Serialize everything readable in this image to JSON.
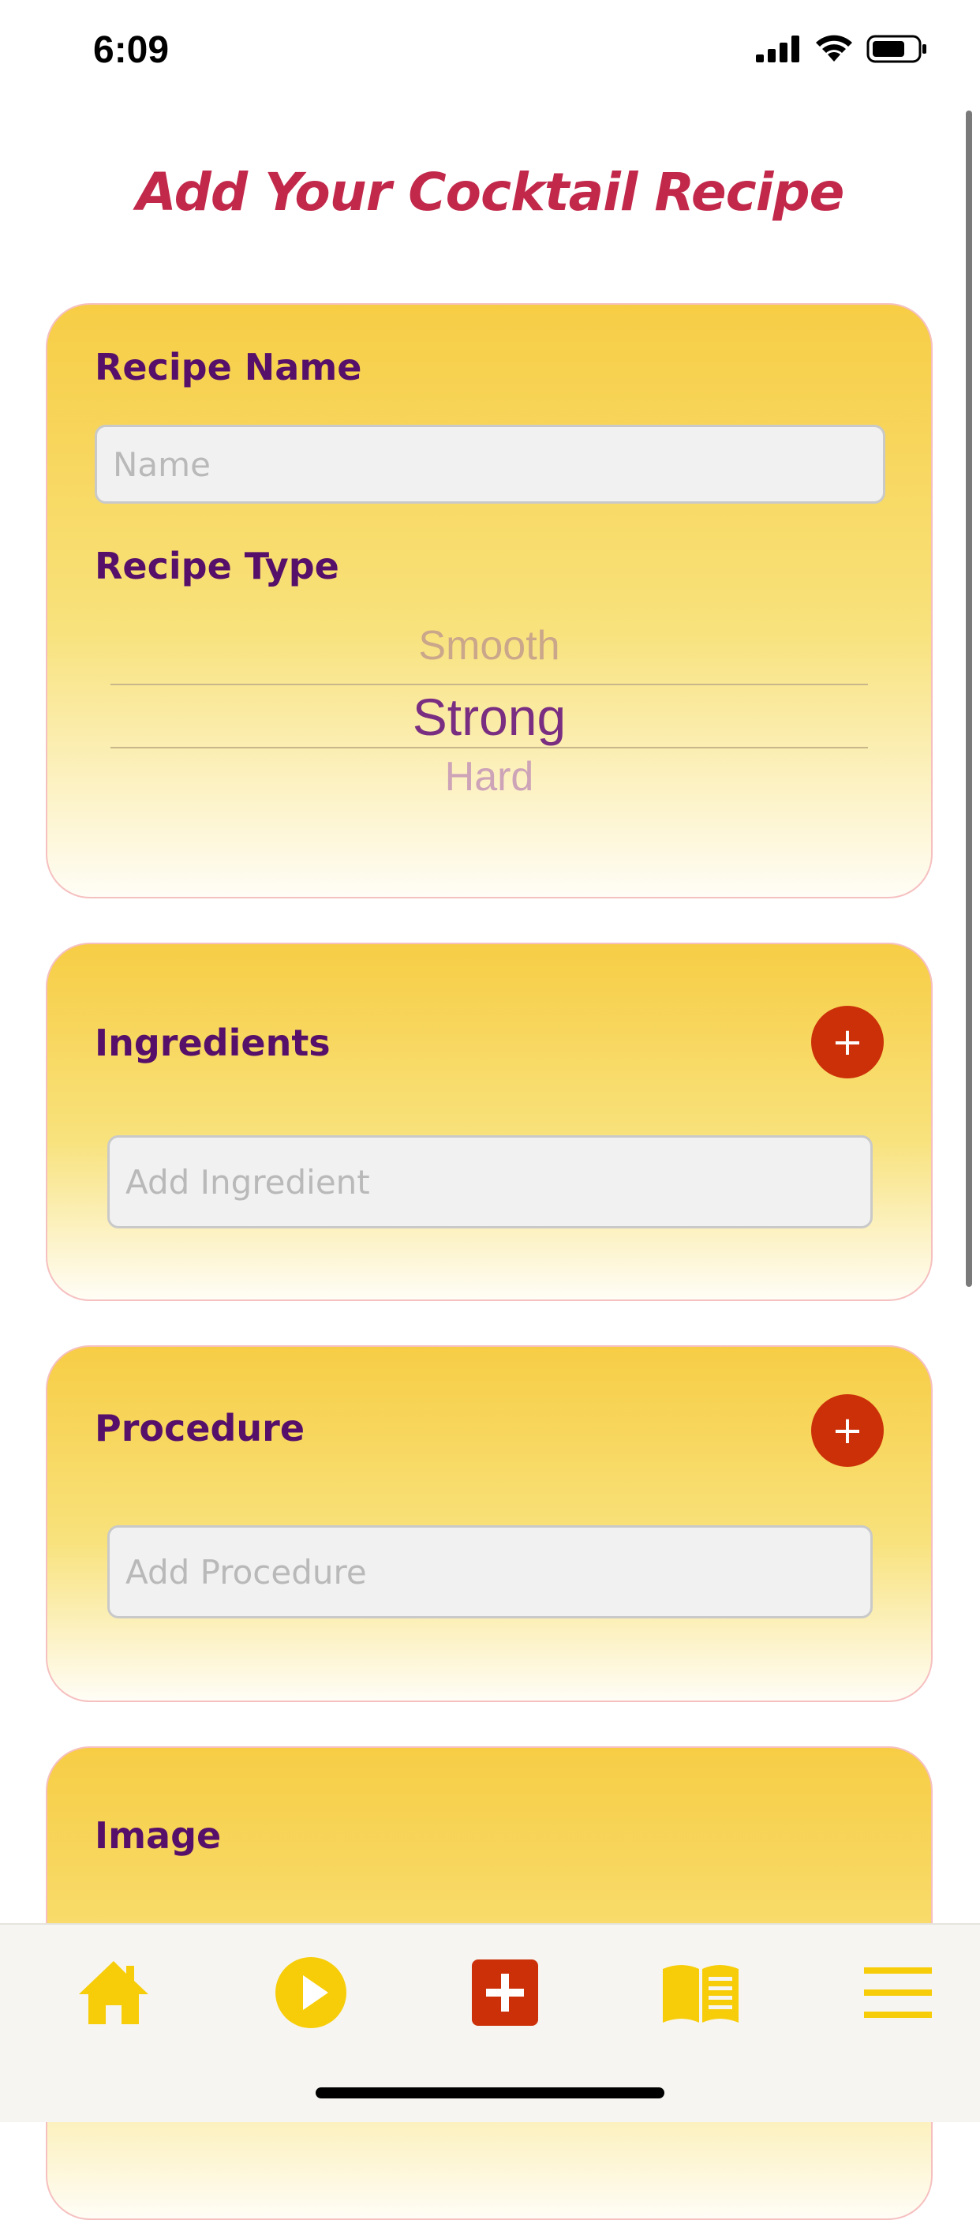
{
  "status_bar": {
    "time": "6:09"
  },
  "title": "Add Your Cocktail Recipe",
  "recipe_card": {
    "name_label": "Recipe Name",
    "name_placeholder": "Name",
    "type_label": "Recipe Type",
    "picker": {
      "above": "Smooth",
      "selected": "Strong",
      "below": "Hard"
    }
  },
  "ingredients_card": {
    "label": "Ingredients",
    "add_label": "+",
    "input_placeholder": "Add Ingredient"
  },
  "procedure_card": {
    "label": "Procedure",
    "add_label": "+",
    "input_placeholder": "Add Procedure"
  },
  "image_card": {
    "label": "Image"
  },
  "tab_bar": {
    "items": [
      {
        "icon": "home-icon"
      },
      {
        "icon": "play-icon"
      },
      {
        "icon": "add-icon"
      },
      {
        "icon": "book-icon"
      },
      {
        "icon": "menu-icon"
      }
    ]
  },
  "colors": {
    "title": "#c2284a",
    "label": "#56106a",
    "accent": "#cc3008",
    "tab_icon": "#f7cd0a",
    "card_top": "#f7cd45",
    "card_bottom": "#fffdf6"
  }
}
